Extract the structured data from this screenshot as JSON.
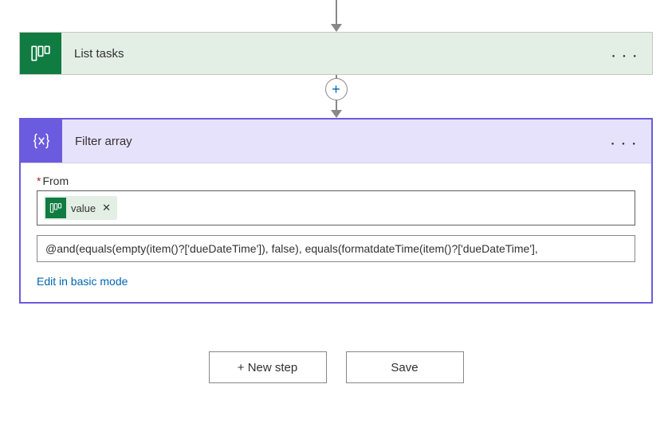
{
  "steps": {
    "listTasks": {
      "title": "List tasks",
      "iconName": "planner-board-icon",
      "accent": "#107c41"
    },
    "filterArray": {
      "title": "Filter array",
      "iconName": "braces-variable-icon",
      "accent": "#6b5bde",
      "fields": {
        "from": {
          "label": "From",
          "required": true,
          "token": {
            "label": "value",
            "sourceIcon": "planner-board-icon"
          }
        },
        "condition": {
          "expression": "@and(equals(empty(item()?['dueDateTime']), false), equals(formatdateTime(item()?['dueDateTime'],"
        }
      },
      "basicModeLink": "Edit in basic mode"
    }
  },
  "insertStep": {
    "label": "+"
  },
  "footer": {
    "newStep": "+ New step",
    "save": "Save"
  }
}
